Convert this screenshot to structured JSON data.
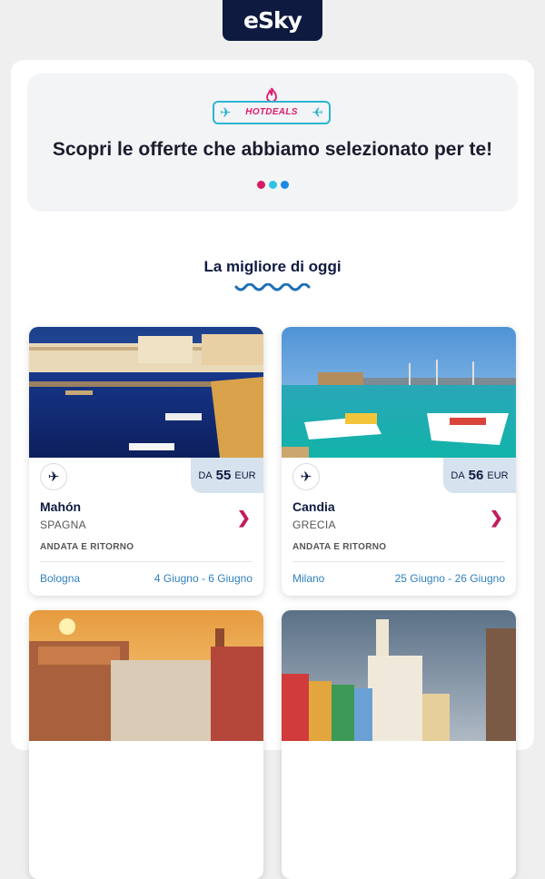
{
  "brand": {
    "logo": "eSky"
  },
  "hero": {
    "badge": "HOTDEALS",
    "title": "Scopri le offerte che abbiamo selezionato per te!",
    "dot_colors": [
      "#d81b60",
      "#2ec4e6",
      "#1e88e5"
    ]
  },
  "section": {
    "title": "La migliore di oggi"
  },
  "deals": [
    {
      "price_prefix": "DA",
      "price": "55",
      "currency": "EUR",
      "city": "Mahón",
      "country": "SPAGNA",
      "trip_type": "ANDATA E RITORNO",
      "from": "Bologna",
      "dates": "4 Giugno - 6 Giugno"
    },
    {
      "price_prefix": "DA",
      "price": "56",
      "currency": "EUR",
      "city": "Candia",
      "country": "GRECIA",
      "trip_type": "ANDATA E RITORNO",
      "from": "Milano",
      "dates": "25 Giugno - 26 Giugno"
    }
  ],
  "colors": {
    "navy": "#0f1a40",
    "accent": "#c21c5c",
    "link": "#2f80bf",
    "cyan": "#2bb6d0"
  }
}
